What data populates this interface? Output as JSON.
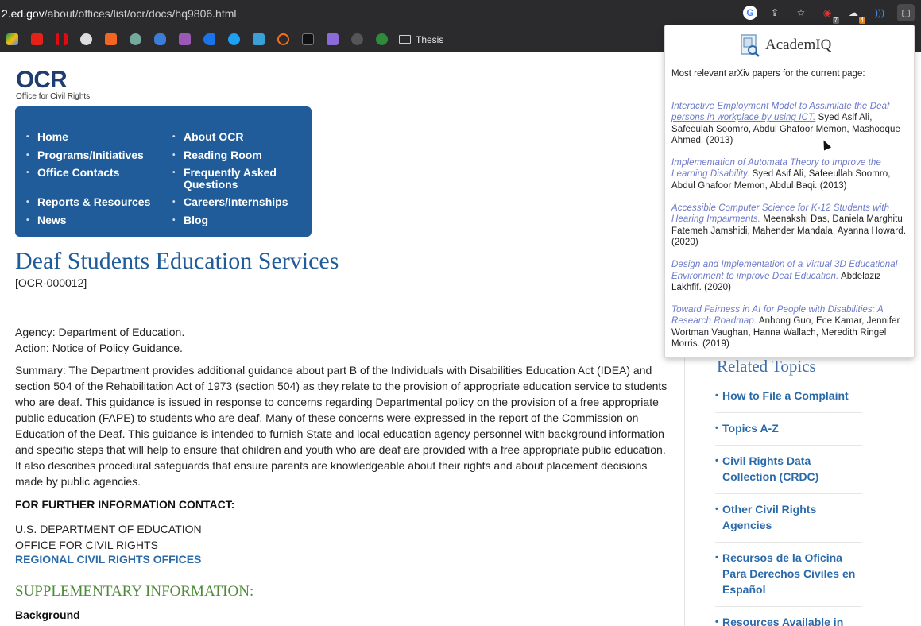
{
  "browser": {
    "url_host": "2.ed.gov",
    "url_path": "/about/offices/list/ocr/docs/hq9806.html",
    "extension_badges": [
      "7",
      "4"
    ],
    "bookmark_folder": "Thesis"
  },
  "logo": {
    "acronym": "OCR",
    "name": "Office for Civil Rights"
  },
  "nav": {
    "left": [
      "Home",
      "Programs/Initiatives",
      "Office Contacts",
      "Reports & Resources",
      "News"
    ],
    "right": [
      "About OCR",
      "Reading Room",
      "Frequently Asked Questions",
      "Careers/Internships",
      "Blog"
    ]
  },
  "doc": {
    "title": "Deaf Students Education Services",
    "number": "[OCR-000012]",
    "agency": "Agency: Department of Education.",
    "action": "Action: Notice of Policy Guidance.",
    "summary": "Summary: The Department provides additional guidance about part B of the Individuals with Disabilities Education Act (IDEA) and section 504 of the Rehabilitation Act of 1973 (section 504) as they relate to the provision of appropriate education service to students who are deaf. This guidance is issued in response to concerns regarding Departmental policy on the provision of a free appropriate public education (FAPE) to students who are deaf. Many of these concerns were expressed in the report of the Commission on Education of the Deaf. This guidance is intended to furnish State and local education agency personnel with background information and specific steps that will help to ensure that children and youth who are deaf are provided with a free appropriate public education. It also describes procedural safeguards that ensure parents are knowledgeable about their rights and about placement decisions made by public agencies.",
    "contact_heading": "FOR FURTHER INFORMATION CONTACT:",
    "contact_line1": "U.S. DEPARTMENT OF EDUCATION",
    "contact_line2": "OFFICE FOR CIVIL RIGHTS",
    "regional_link": "REGIONAL CIVIL RIGHTS OFFICES",
    "supplementary": "SUPPLEMENTARY INFORMATION:",
    "background": "Background"
  },
  "related": {
    "title": "Related Topics",
    "items": [
      "How to File a Complaint",
      "Topics A-Z",
      "Civil Rights Data Collection (CRDC)",
      "Other Civil Rights Agencies",
      "Recursos de la Oficina Para Derechos Civiles en Español",
      "Resources Available in"
    ]
  },
  "popup": {
    "brand": "AcademIQ",
    "subtitle": "Most relevant arXiv papers for the current page:",
    "papers": [
      {
        "title": "Interactive Employment Model to Assimilate the Deaf persons in workplace by using ICT.",
        "meta": " Syed Asif Ali, Safeeulah Soomro, Abdul Ghafoor Memon, Mashooque Ahmed. (2013)"
      },
      {
        "title": "Implementation of Automata Theory to Improve the Learning Disability.",
        "meta": " Syed Asif Ali, Safeeullah Soomro, Abdul Ghafoor Memon, Abdul Baqi. (2013)"
      },
      {
        "title": "Accessible Computer Science for K-12 Students with Hearing Impairments.",
        "meta": " Meenakshi Das, Daniela Marghitu, Fatemeh Jamshidi, Mahender Mandala, Ayanna Howard. (2020)"
      },
      {
        "title": "Design and Implementation of a Virtual 3D Educational Environment to improve Deaf Education.",
        "meta": " Abdelaziz Lakhfif. (2020)"
      },
      {
        "title": "Toward Fairness in AI for People with Disabilities: A Research Roadmap.",
        "meta": " Anhong Guo, Ece Kamar, Jennifer Wortman Vaughan, Hanna Wallach, Meredith Ringel Morris. (2019)"
      }
    ]
  },
  "colors": {
    "nav_bg": "#1f5c99",
    "title_blue": "#1f5c99",
    "link_blue": "#2a6aaa",
    "supp_green": "#4e8a3a",
    "paper_link": "#6c79c9",
    "chrome_bg": "#2b2b2d"
  }
}
